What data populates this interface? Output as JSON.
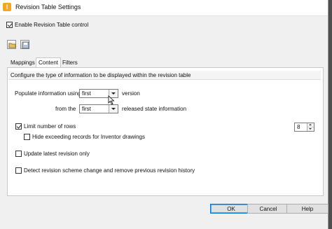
{
  "window": {
    "title": "Revision Table Settings",
    "app_icon_letter": "I"
  },
  "enable_control": {
    "label": "Enable Revision Table control",
    "checked": true
  },
  "toolbar": {
    "icons": [
      "open-folder-icon",
      "save-settings-icon"
    ]
  },
  "tabs": [
    {
      "label": "Mappings",
      "active": false
    },
    {
      "label": "Content",
      "active": true
    },
    {
      "label": "Filters",
      "active": false
    }
  ],
  "content": {
    "info": "Configure the type of information to be displayed within the revision table",
    "populate": {
      "label": "Populate information using",
      "value": "first",
      "suffix": "version"
    },
    "from": {
      "label": "from the",
      "value": "first",
      "suffix": "released state information"
    },
    "limit_rows": {
      "label": "Limit number of rows",
      "checked": true,
      "value": "8"
    },
    "hide_exceeding": {
      "label": "Hide exceeding records for Inventor drawings",
      "checked": false
    },
    "update_latest": {
      "label": "Update latest revision only",
      "checked": false
    },
    "detect_scheme": {
      "label": "Detect revision scheme change and remove previous revision history",
      "checked": false
    }
  },
  "buttons": {
    "ok": "OK",
    "cancel": "Cancel",
    "help": "Help"
  },
  "colors": {
    "accent": "#0078d7",
    "app_icon": "#f6a623"
  }
}
